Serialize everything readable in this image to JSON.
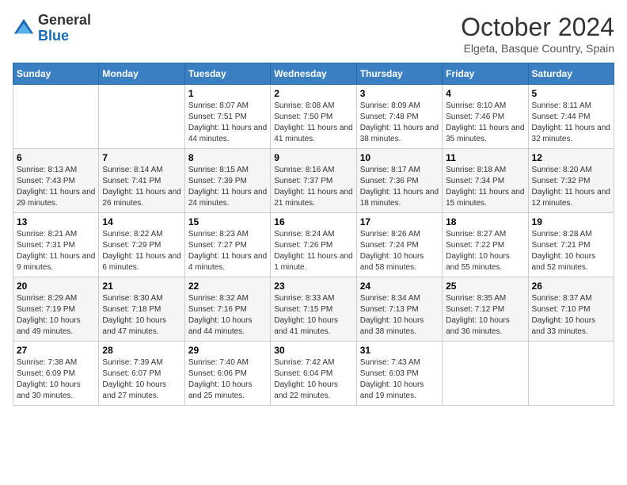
{
  "header": {
    "logo_line1": "General",
    "logo_line2": "Blue",
    "month": "October 2024",
    "location": "Elgeta, Basque Country, Spain"
  },
  "days_of_week": [
    "Sunday",
    "Monday",
    "Tuesday",
    "Wednesday",
    "Thursday",
    "Friday",
    "Saturday"
  ],
  "weeks": [
    [
      {
        "day": "",
        "info": ""
      },
      {
        "day": "",
        "info": ""
      },
      {
        "day": "1",
        "info": "Sunrise: 8:07 AM\nSunset: 7:51 PM\nDaylight: 11 hours and 44 minutes."
      },
      {
        "day": "2",
        "info": "Sunrise: 8:08 AM\nSunset: 7:50 PM\nDaylight: 11 hours and 41 minutes."
      },
      {
        "day": "3",
        "info": "Sunrise: 8:09 AM\nSunset: 7:48 PM\nDaylight: 11 hours and 38 minutes."
      },
      {
        "day": "4",
        "info": "Sunrise: 8:10 AM\nSunset: 7:46 PM\nDaylight: 11 hours and 35 minutes."
      },
      {
        "day": "5",
        "info": "Sunrise: 8:11 AM\nSunset: 7:44 PM\nDaylight: 11 hours and 32 minutes."
      }
    ],
    [
      {
        "day": "6",
        "info": "Sunrise: 8:13 AM\nSunset: 7:43 PM\nDaylight: 11 hours and 29 minutes."
      },
      {
        "day": "7",
        "info": "Sunrise: 8:14 AM\nSunset: 7:41 PM\nDaylight: 11 hours and 26 minutes."
      },
      {
        "day": "8",
        "info": "Sunrise: 8:15 AM\nSunset: 7:39 PM\nDaylight: 11 hours and 24 minutes."
      },
      {
        "day": "9",
        "info": "Sunrise: 8:16 AM\nSunset: 7:37 PM\nDaylight: 11 hours and 21 minutes."
      },
      {
        "day": "10",
        "info": "Sunrise: 8:17 AM\nSunset: 7:36 PM\nDaylight: 11 hours and 18 minutes."
      },
      {
        "day": "11",
        "info": "Sunrise: 8:18 AM\nSunset: 7:34 PM\nDaylight: 11 hours and 15 minutes."
      },
      {
        "day": "12",
        "info": "Sunrise: 8:20 AM\nSunset: 7:32 PM\nDaylight: 11 hours and 12 minutes."
      }
    ],
    [
      {
        "day": "13",
        "info": "Sunrise: 8:21 AM\nSunset: 7:31 PM\nDaylight: 11 hours and 9 minutes."
      },
      {
        "day": "14",
        "info": "Sunrise: 8:22 AM\nSunset: 7:29 PM\nDaylight: 11 hours and 6 minutes."
      },
      {
        "day": "15",
        "info": "Sunrise: 8:23 AM\nSunset: 7:27 PM\nDaylight: 11 hours and 4 minutes."
      },
      {
        "day": "16",
        "info": "Sunrise: 8:24 AM\nSunset: 7:26 PM\nDaylight: 11 hours and 1 minute."
      },
      {
        "day": "17",
        "info": "Sunrise: 8:26 AM\nSunset: 7:24 PM\nDaylight: 10 hours and 58 minutes."
      },
      {
        "day": "18",
        "info": "Sunrise: 8:27 AM\nSunset: 7:22 PM\nDaylight: 10 hours and 55 minutes."
      },
      {
        "day": "19",
        "info": "Sunrise: 8:28 AM\nSunset: 7:21 PM\nDaylight: 10 hours and 52 minutes."
      }
    ],
    [
      {
        "day": "20",
        "info": "Sunrise: 8:29 AM\nSunset: 7:19 PM\nDaylight: 10 hours and 49 minutes."
      },
      {
        "day": "21",
        "info": "Sunrise: 8:30 AM\nSunset: 7:18 PM\nDaylight: 10 hours and 47 minutes."
      },
      {
        "day": "22",
        "info": "Sunrise: 8:32 AM\nSunset: 7:16 PM\nDaylight: 10 hours and 44 minutes."
      },
      {
        "day": "23",
        "info": "Sunrise: 8:33 AM\nSunset: 7:15 PM\nDaylight: 10 hours and 41 minutes."
      },
      {
        "day": "24",
        "info": "Sunrise: 8:34 AM\nSunset: 7:13 PM\nDaylight: 10 hours and 38 minutes."
      },
      {
        "day": "25",
        "info": "Sunrise: 8:35 AM\nSunset: 7:12 PM\nDaylight: 10 hours and 36 minutes."
      },
      {
        "day": "26",
        "info": "Sunrise: 8:37 AM\nSunset: 7:10 PM\nDaylight: 10 hours and 33 minutes."
      }
    ],
    [
      {
        "day": "27",
        "info": "Sunrise: 7:38 AM\nSunset: 6:09 PM\nDaylight: 10 hours and 30 minutes."
      },
      {
        "day": "28",
        "info": "Sunrise: 7:39 AM\nSunset: 6:07 PM\nDaylight: 10 hours and 27 minutes."
      },
      {
        "day": "29",
        "info": "Sunrise: 7:40 AM\nSunset: 6:06 PM\nDaylight: 10 hours and 25 minutes."
      },
      {
        "day": "30",
        "info": "Sunrise: 7:42 AM\nSunset: 6:04 PM\nDaylight: 10 hours and 22 minutes."
      },
      {
        "day": "31",
        "info": "Sunrise: 7:43 AM\nSunset: 6:03 PM\nDaylight: 10 hours and 19 minutes."
      },
      {
        "day": "",
        "info": ""
      },
      {
        "day": "",
        "info": ""
      }
    ]
  ]
}
